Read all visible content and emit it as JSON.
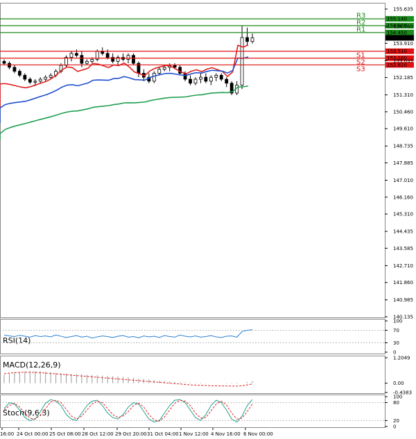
{
  "chart_data": {
    "type": "candlestick",
    "y_axis": {
      "ticks": [
        "155.635",
        "154.760",
        "153.910",
        "153.035",
        "152.185",
        "151.310",
        "150.460",
        "149.610",
        "148.735",
        "147.885",
        "147.010",
        "146.160",
        "145.310",
        "144.435",
        "143.585",
        "142.710",
        "141.860",
        "140.985",
        "140.135"
      ],
      "ylim": [
        140.1,
        155.95
      ]
    },
    "x_axis": {
      "tick_labels": [
        "16:00",
        "24 Oct 00:00",
        "25 Oct 08:00",
        "28 Oct 12:00",
        "29 Oct 20:00",
        "31 Oct 04:00",
        "1 Nov 12:00",
        "4 Nov 16:00",
        "6 Nov 00:00"
      ]
    },
    "levels": [
      {
        "name": "R3",
        "value": 155.14,
        "label": "155.140",
        "color": "#1a8a1a"
      },
      {
        "name": "R2",
        "value": 154.8,
        "label": "154.800",
        "color": "#1a8a1a"
      },
      {
        "name": "R1",
        "value": 154.45,
        "label": "154.450",
        "color": "#1a8a1a"
      },
      {
        "name": "S1",
        "value": 153.51,
        "label": "153.510",
        "color": "#e01010"
      },
      {
        "name": "S2",
        "value": 153.16,
        "label": "153.160",
        "color": "#e01010"
      },
      {
        "name": "S3",
        "value": 152.82,
        "label": "152.820",
        "color": "#e01010"
      }
    ],
    "current_price": {
      "value": 154.183,
      "label": "154.183",
      "color": "#000000"
    },
    "candles": [
      [
        153.0,
        153.1,
        152.8,
        152.9
      ],
      [
        152.9,
        153.0,
        152.6,
        152.7
      ],
      [
        152.7,
        152.8,
        152.4,
        152.5
      ],
      [
        152.5,
        152.6,
        152.2,
        152.3
      ],
      [
        152.3,
        152.4,
        152.0,
        152.1
      ],
      [
        152.1,
        152.2,
        151.85,
        151.95
      ],
      [
        151.95,
        152.1,
        151.75,
        152.0
      ],
      [
        152.0,
        152.2,
        151.9,
        152.1
      ],
      [
        152.1,
        152.3,
        152.0,
        152.2
      ],
      [
        152.2,
        152.4,
        152.1,
        152.3
      ],
      [
        152.3,
        152.6,
        152.2,
        152.5
      ],
      [
        152.5,
        152.9,
        152.4,
        152.8
      ],
      [
        152.8,
        153.3,
        152.7,
        153.2
      ],
      [
        153.2,
        153.5,
        153.0,
        153.4
      ],
      [
        153.4,
        153.6,
        153.2,
        153.3
      ],
      [
        153.3,
        153.5,
        152.7,
        152.9
      ],
      [
        152.9,
        153.1,
        152.8,
        153.0
      ],
      [
        153.0,
        153.2,
        152.9,
        153.1
      ],
      [
        153.1,
        153.6,
        153.0,
        153.5
      ],
      [
        153.5,
        153.7,
        153.3,
        153.4
      ],
      [
        153.4,
        153.6,
        153.1,
        153.2
      ],
      [
        153.2,
        153.4,
        152.9,
        153.0
      ],
      [
        153.0,
        153.3,
        152.8,
        153.2
      ],
      [
        153.2,
        153.4,
        153.0,
        153.1
      ],
      [
        153.1,
        153.4,
        152.9,
        153.3
      ],
      [
        153.3,
        153.4,
        152.8,
        152.9
      ],
      [
        152.9,
        153.0,
        152.2,
        152.4
      ],
      [
        152.4,
        152.6,
        152.0,
        152.2
      ],
      [
        152.2,
        152.4,
        151.9,
        152.0
      ],
      [
        152.0,
        152.5,
        151.9,
        152.4
      ],
      [
        152.4,
        152.7,
        152.3,
        152.6
      ],
      [
        152.6,
        152.8,
        152.5,
        152.7
      ],
      [
        152.7,
        152.9,
        152.5,
        152.8
      ],
      [
        152.8,
        152.9,
        152.6,
        152.7
      ],
      [
        152.7,
        152.8,
        152.3,
        152.4
      ],
      [
        152.4,
        152.5,
        152.0,
        152.1
      ],
      [
        152.1,
        152.3,
        151.8,
        151.9
      ],
      [
        151.9,
        152.2,
        151.8,
        152.1
      ],
      [
        152.1,
        152.4,
        151.9,
        152.2
      ],
      [
        152.2,
        152.4,
        151.9,
        152.0
      ],
      [
        152.0,
        152.3,
        151.8,
        152.2
      ],
      [
        152.2,
        152.4,
        152.0,
        152.3
      ],
      [
        152.3,
        152.4,
        152.0,
        152.1
      ],
      [
        152.1,
        152.2,
        151.7,
        151.9
      ],
      [
        151.9,
        152.0,
        151.3,
        151.4
      ],
      [
        151.4,
        152.0,
        151.3,
        151.8
      ],
      [
        151.8,
        154.8,
        151.6,
        154.2
      ],
      [
        154.2,
        154.7,
        153.8,
        154.0
      ],
      [
        154.0,
        154.4,
        153.9,
        154.18
      ]
    ],
    "ma_series": [
      {
        "color": "#e02020",
        "start": 150.6,
        "end": 153.4
      },
      {
        "color": "#2050d0",
        "start": 149.9,
        "end": 152.9
      },
      {
        "color": "#20a050",
        "start": 149.05,
        "end": 151.55
      }
    ],
    "rsi": {
      "label": "RSI(14)",
      "ticks": [
        "100",
        "70",
        "30",
        "0"
      ],
      "ylim": [
        0,
        100
      ],
      "values": [
        55,
        52,
        50,
        54,
        51,
        48,
        53,
        50,
        52,
        49,
        55,
        51,
        47,
        50,
        53,
        48,
        51,
        45,
        49,
        52,
        50,
        47,
        51,
        53,
        48,
        50,
        46,
        52,
        49,
        51,
        47,
        53,
        50,
        48,
        55,
        51,
        49,
        52,
        48,
        50,
        53,
        49,
        47,
        51,
        52,
        48,
        66,
        70,
        72
      ]
    },
    "macd": {
      "label": "MACD(12,26,9)",
      "ticks": [
        "1.2049",
        "0.00",
        "-0.4383"
      ],
      "ylim": [
        -0.4383,
        1.2049
      ],
      "histogram": [
        0.4,
        0.45,
        0.5,
        0.52,
        0.55,
        0.56,
        0.58,
        0.57,
        0.55,
        0.52,
        0.5,
        0.48,
        0.46,
        0.44,
        0.43,
        0.42,
        0.4,
        0.39,
        0.38,
        0.36,
        0.35,
        0.33,
        0.32,
        0.3,
        0.28,
        0.25,
        0.22,
        0.2,
        0.18,
        0.15,
        0.12,
        0.1,
        0.08,
        0.06,
        0.05,
        0.04,
        0.03,
        0.02,
        0.02,
        0.01,
        0.01,
        0.0,
        0.0,
        -0.01,
        -0.02,
        -0.03,
        0.0,
        0.05,
        0.1
      ],
      "signal": [
        0.45,
        0.48,
        0.5,
        0.51,
        0.52,
        0.52,
        0.51,
        0.5,
        0.48,
        0.46,
        0.44,
        0.42,
        0.4,
        0.38,
        0.36,
        0.34,
        0.32,
        0.3,
        0.28,
        0.26,
        0.24,
        0.22,
        0.2,
        0.18,
        0.16,
        0.14,
        0.12,
        0.1,
        0.08,
        0.06,
        0.04,
        0.02,
        0.0,
        -0.02,
        -0.04,
        -0.06,
        -0.08,
        -0.09,
        -0.1,
        -0.11,
        -0.12,
        -0.12,
        -0.13,
        -0.13,
        -0.14,
        -0.14,
        -0.12,
        -0.08,
        -0.04
      ]
    },
    "stoch": {
      "label": "Stoch(9,6,3)",
      "ticks": [
        "100",
        "80",
        "20",
        "0"
      ],
      "ylim": [
        0,
        100
      ],
      "k": [
        60,
        80,
        75,
        55,
        30,
        20,
        25,
        50,
        78,
        90,
        85,
        70,
        40,
        25,
        20,
        45,
        70,
        85,
        88,
        70,
        45,
        30,
        25,
        40,
        65,
        80,
        75,
        50,
        25,
        15,
        20,
        45,
        70,
        88,
        90,
        80,
        55,
        30,
        20,
        40,
        70,
        88,
        80,
        55,
        25,
        15,
        35,
        70,
        90
      ],
      "d": [
        55,
        70,
        78,
        65,
        45,
        28,
        25,
        38,
        60,
        82,
        88,
        80,
        58,
        35,
        25,
        35,
        55,
        75,
        85,
        80,
        60,
        40,
        30,
        35,
        50,
        70,
        78,
        65,
        40,
        22,
        18,
        32,
        55,
        78,
        88,
        85,
        70,
        45,
        28,
        30,
        52,
        75,
        85,
        72,
        45,
        25,
        28,
        50,
        75
      ]
    }
  }
}
